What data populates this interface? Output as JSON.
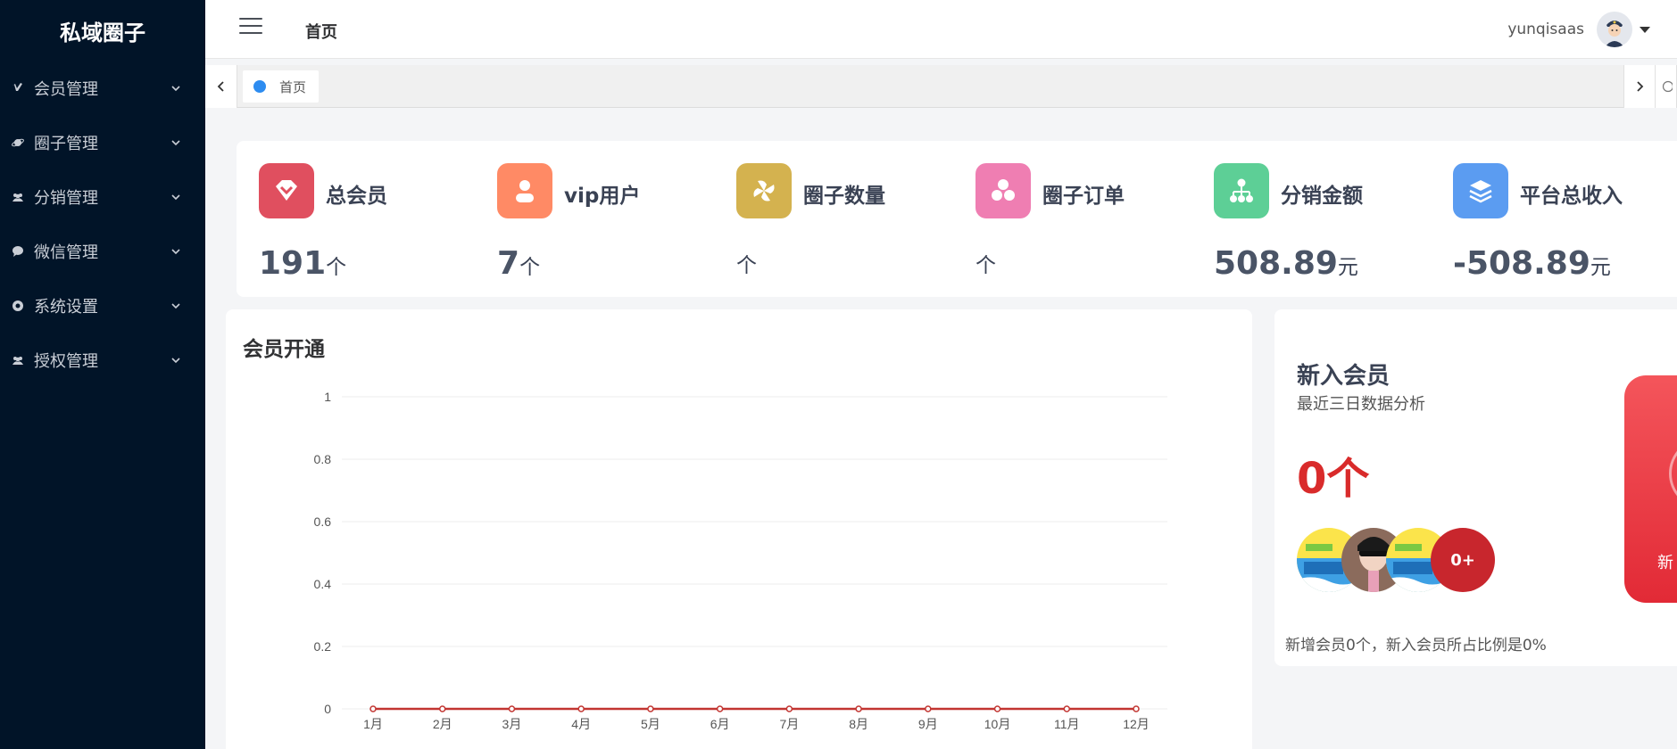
{
  "sidebar": {
    "brand": "私域圈子",
    "items": [
      {
        "label": "会员管理",
        "icon": "vimeo-icon"
      },
      {
        "label": "圈子管理",
        "icon": "planet-icon"
      },
      {
        "label": "分销管理",
        "icon": "users-icon"
      },
      {
        "label": "微信管理",
        "icon": "chat-icon"
      },
      {
        "label": "系统设置",
        "icon": "settings-icon"
      },
      {
        "label": "授权管理",
        "icon": "team-icon"
      }
    ]
  },
  "header": {
    "breadcrumb": "首页",
    "username": "yunqisaas"
  },
  "tabs": [
    {
      "label": "首页",
      "active": true
    }
  ],
  "stats": [
    {
      "label": "总会员",
      "value": "191",
      "unit": "个",
      "color": "#e04f5f",
      "icon": "heart-diamond-icon"
    },
    {
      "label": "vip用户",
      "value": "7",
      "unit": "个",
      "color": "#ff8a65",
      "icon": "user-icon"
    },
    {
      "label": "圈子数量",
      "value": "",
      "unit": "个",
      "color": "#d4b24f",
      "icon": "pinwheel-icon"
    },
    {
      "label": "圈子订单",
      "value": "",
      "unit": "个",
      "color": "#ef7eb2",
      "icon": "cubes-icon"
    },
    {
      "label": "分销金额",
      "value": "508.89",
      "unit": "元",
      "color": "#5dcf96",
      "icon": "org-chart-icon"
    },
    {
      "label": "平台总收入",
      "value": "-508.89",
      "unit": "元",
      "color": "#5b9cf1",
      "icon": "layers-icon"
    }
  ],
  "member_chart": {
    "title": "会员开通"
  },
  "chart_data": {
    "type": "line",
    "title": "会员开通",
    "categories": [
      "1月",
      "2月",
      "3月",
      "4月",
      "5月",
      "6月",
      "7月",
      "8月",
      "9月",
      "10月",
      "11月",
      "12月"
    ],
    "values": [
      0,
      0,
      0,
      0,
      0,
      0,
      0,
      0,
      0,
      0,
      0,
      0
    ],
    "yticks": [
      "1",
      "0.8",
      "0.6",
      "0.4",
      "0.2",
      "0"
    ],
    "ylim": [
      0,
      1
    ],
    "grid": true,
    "line_color": "#c23531"
  },
  "new_members": {
    "title": "新入会员",
    "subtitle": "最近三日数据分析",
    "count": "0个",
    "more_badge": "0+",
    "footer": "新增会员0个，新入会员所占比例是0%",
    "red_card_text": "新"
  }
}
